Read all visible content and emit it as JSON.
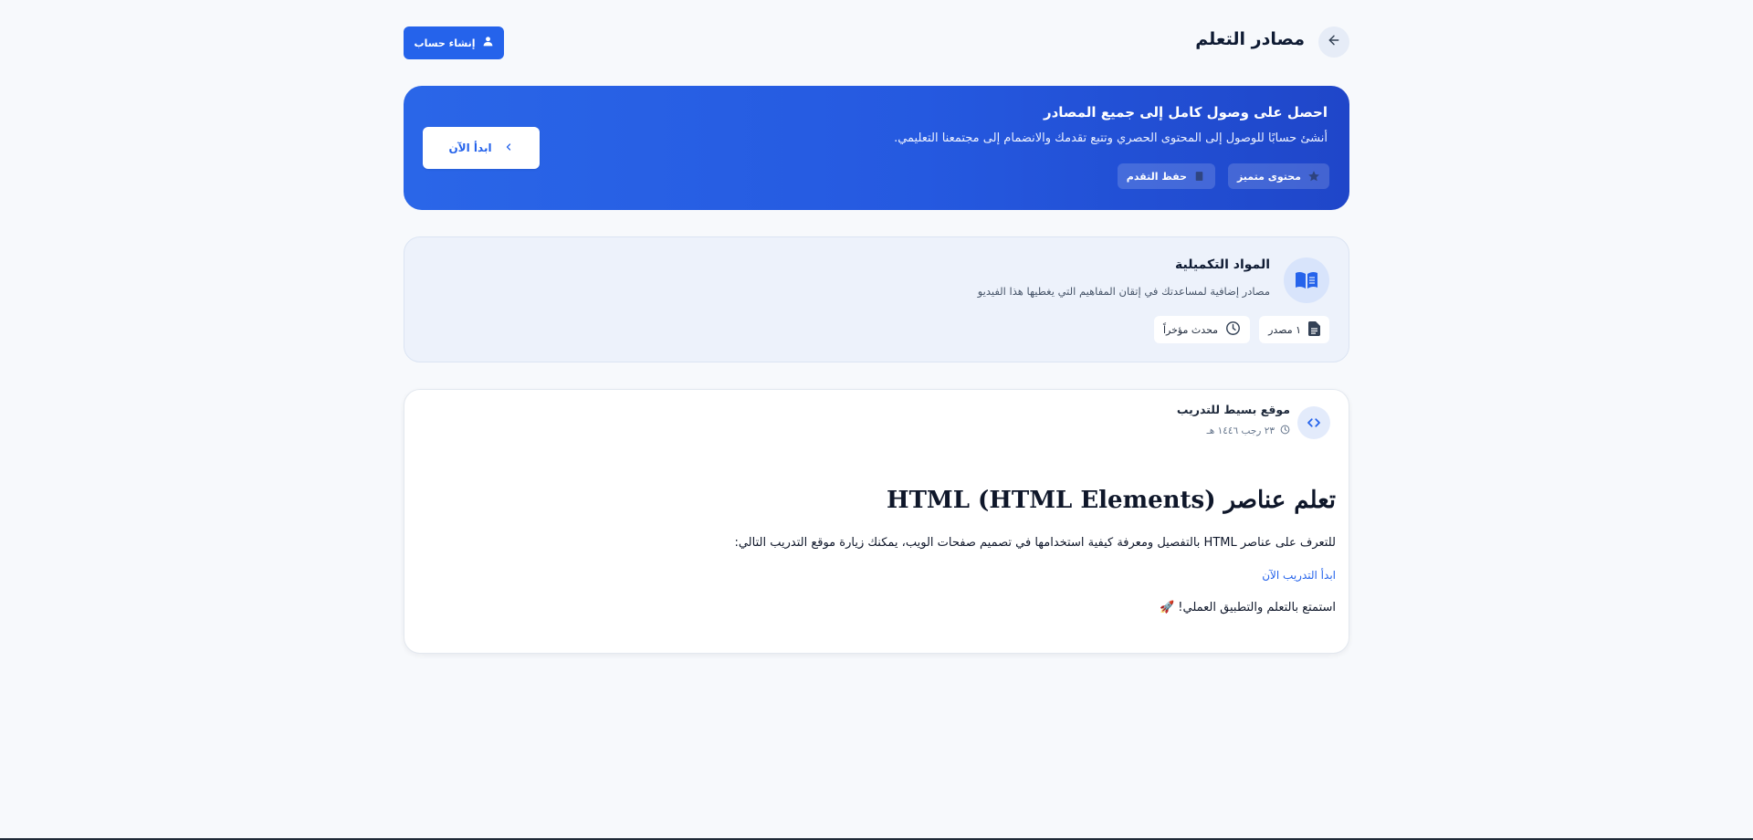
{
  "header": {
    "title": "مصادر التعلم",
    "signup_label": "إنشاء حساب"
  },
  "promo": {
    "title": "احصل على وصول كامل إلى جميع المصادر",
    "description": "أنشئ حسابًا للوصول إلى المحتوى الحصري وتتبع تقدمك والانضمام إلى مجتمعنا التعليمي.",
    "badges": [
      "محتوى متميز",
      "حفظ التقدم"
    ],
    "cta_label": "ابدأ الآن"
  },
  "extra_materials": {
    "title": "المواد التكميلية",
    "description": "مصادر إضافية لمساعدتك في إتقان المفاهيم التي يغطيها هذا الفيديو",
    "count_label": "١ مصدر",
    "updated_label": "محدث مؤخراً"
  },
  "resource": {
    "title": "موقع بسيط للتدريب",
    "date": "٢٣ رجب ١٤٤٦ هـ",
    "heading": "تعلم عناصر HTML (HTML Elements)",
    "body": "للتعرف على عناصر HTML بالتفصيل ومعرفة كيفية استخدامها في تصميم صفحات الويب، يمكنك زيارة موقع التدريب التالي:",
    "link_label": "ابدأ التدريب الآن",
    "outro": "استمتع بالتعلم والتطبيق العملي! 🚀"
  },
  "colors": {
    "accent": "#2563eb",
    "banner_end": "#1f46c9",
    "card_tint": "#edf2fb"
  },
  "icons": [
    "arrow-left-icon",
    "user-icon",
    "chevron-left-icon",
    "star-icon",
    "bookmark-icon",
    "book-open-icon",
    "file-icon",
    "clock-icon",
    "code-icon"
  ]
}
